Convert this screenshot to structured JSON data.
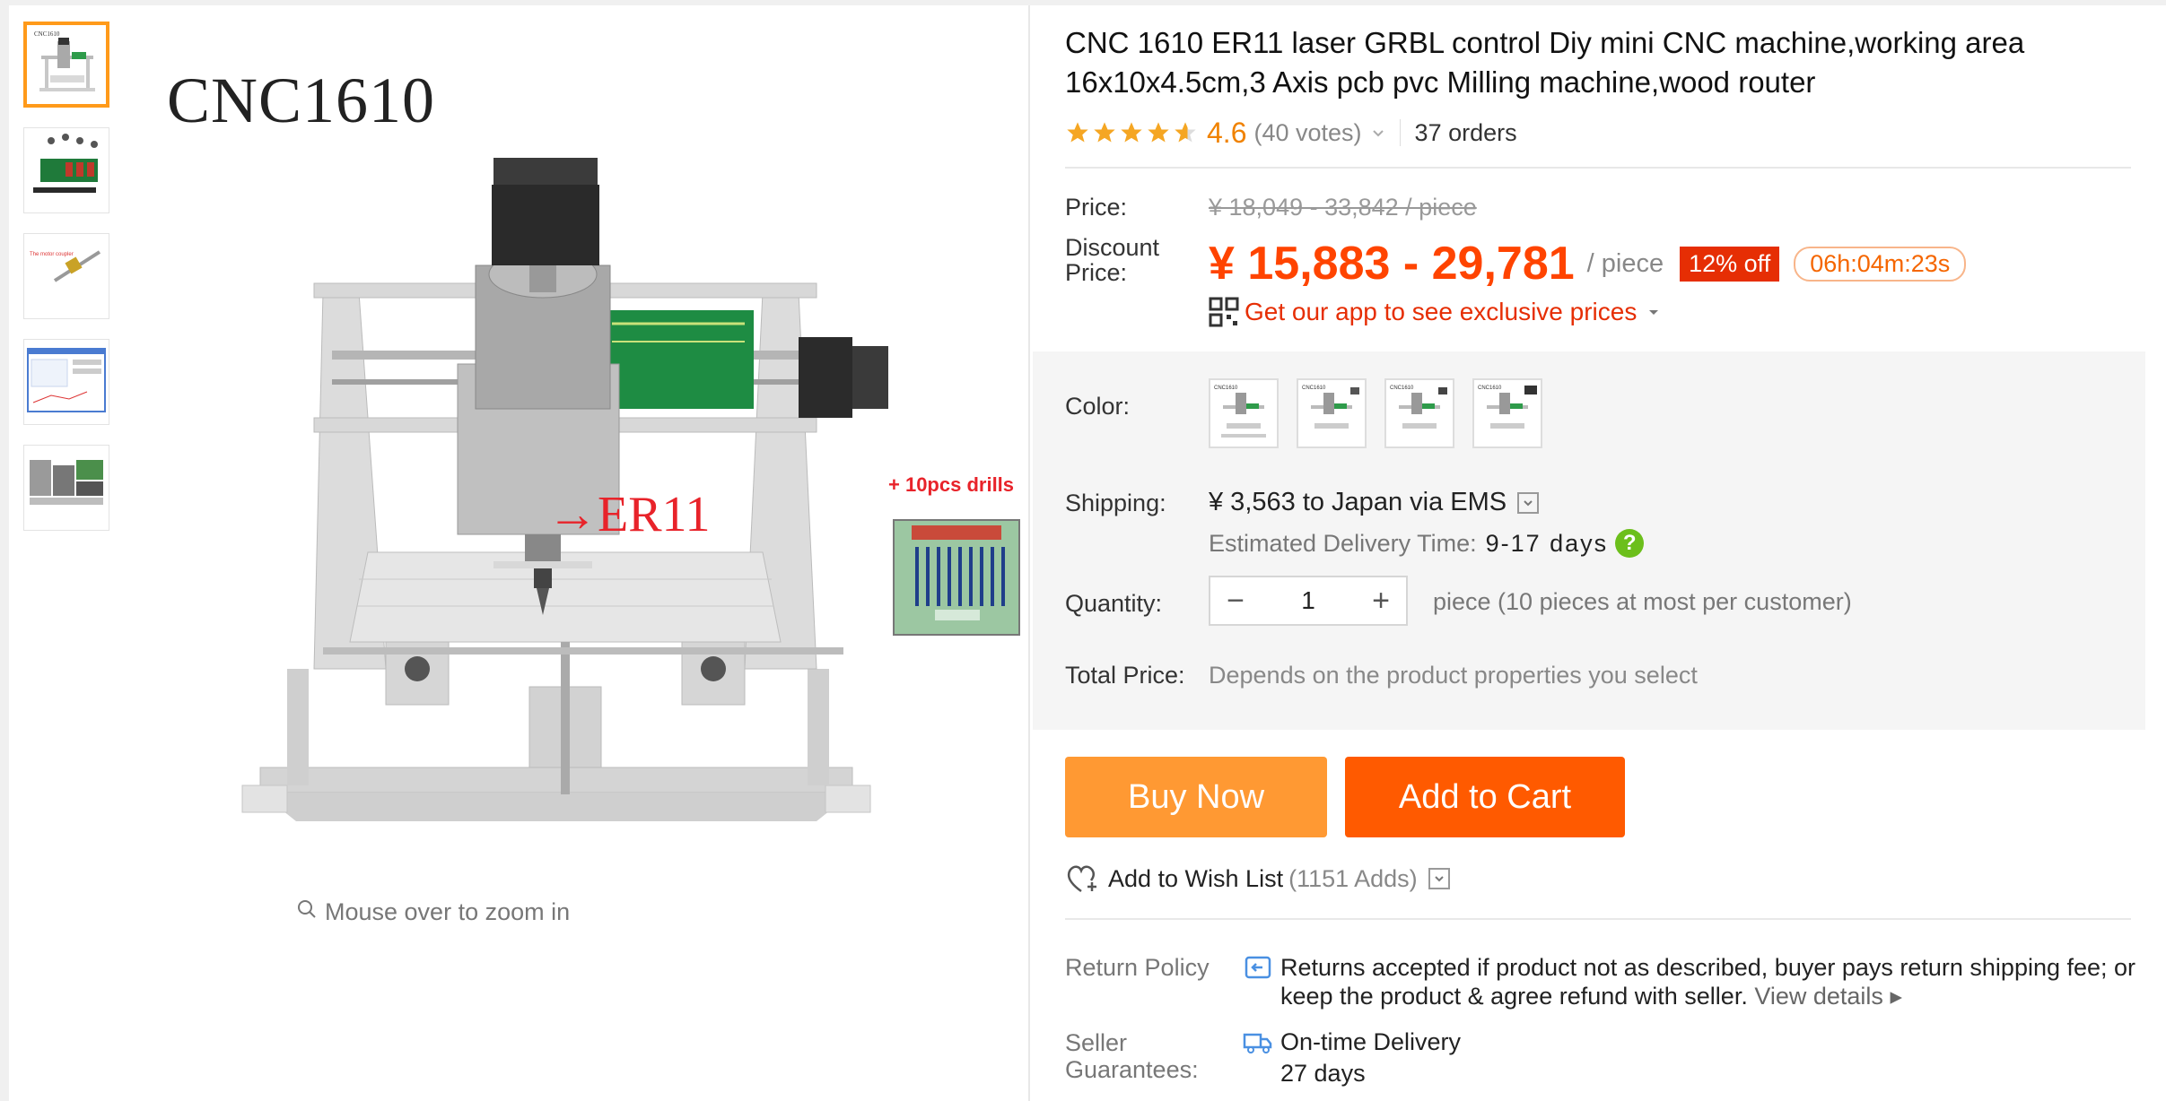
{
  "gallery": {
    "thumbnails": [
      "thumb-cnc-machine",
      "thumb-controller-board",
      "thumb-lead-screw",
      "thumb-software-screenshot",
      "thumb-assembly-photos"
    ],
    "image_label": "CNC1610",
    "er11_label": "→ER11",
    "drills_label": "+ 10pcs  drills",
    "zoom_hint": "Mouse over to zoom in"
  },
  "product": {
    "title": "CNC 1610 ER11 laser GRBL control Diy mini CNC machine,working area 16x10x4.5cm,3 Axis pcb pvc Milling machine,wood router",
    "rating": 4.6,
    "rating_text": "4.6",
    "votes": "(40 votes)",
    "orders": "37 orders"
  },
  "price": {
    "price_label": "Price:",
    "original": "¥ 18,049 - 33,842 / piece",
    "discount_label": "Discount Price:",
    "discount": "¥ 15,883 - 29,781",
    "unit": "/ piece",
    "off_badge": "12% off",
    "countdown": "06h:04m:23s",
    "app_promo": "Get our app to see exclusive prices"
  },
  "options": {
    "color_label": "Color:",
    "colors": [
      "color-option-1",
      "color-option-2",
      "color-option-3",
      "color-option-4"
    ],
    "shipping_label": "Shipping:",
    "shipping_value": "¥ 3,563 to Japan via EMS",
    "delivery_label": "Estimated Delivery Time:",
    "delivery_days": "9-17 days",
    "quantity_label": "Quantity:",
    "quantity": "1",
    "quantity_note": "piece (10 pieces at most per customer)",
    "total_label": "Total Price:",
    "total_note": "Depends on the product properties you select"
  },
  "actions": {
    "buy_now": "Buy Now",
    "add_to_cart": "Add to Cart",
    "wishlist": "Add to Wish List",
    "wishlist_adds": "(1151 Adds)"
  },
  "policies": {
    "return_label": "Return Policy",
    "return_text": "Returns accepted if product not as described, buyer pays return shipping fee; or keep the product & agree refund with seller.",
    "view_details": "View details",
    "seller_label": "Seller Guarantees:",
    "seller_title": "On-time Delivery",
    "seller_days": "27 days"
  },
  "colors": {
    "accent_orange": "#ff9933",
    "cart_orange": "#ff5a00",
    "price_red": "#ff4400",
    "badge_red": "#e62e04",
    "star": "#f5a623"
  }
}
